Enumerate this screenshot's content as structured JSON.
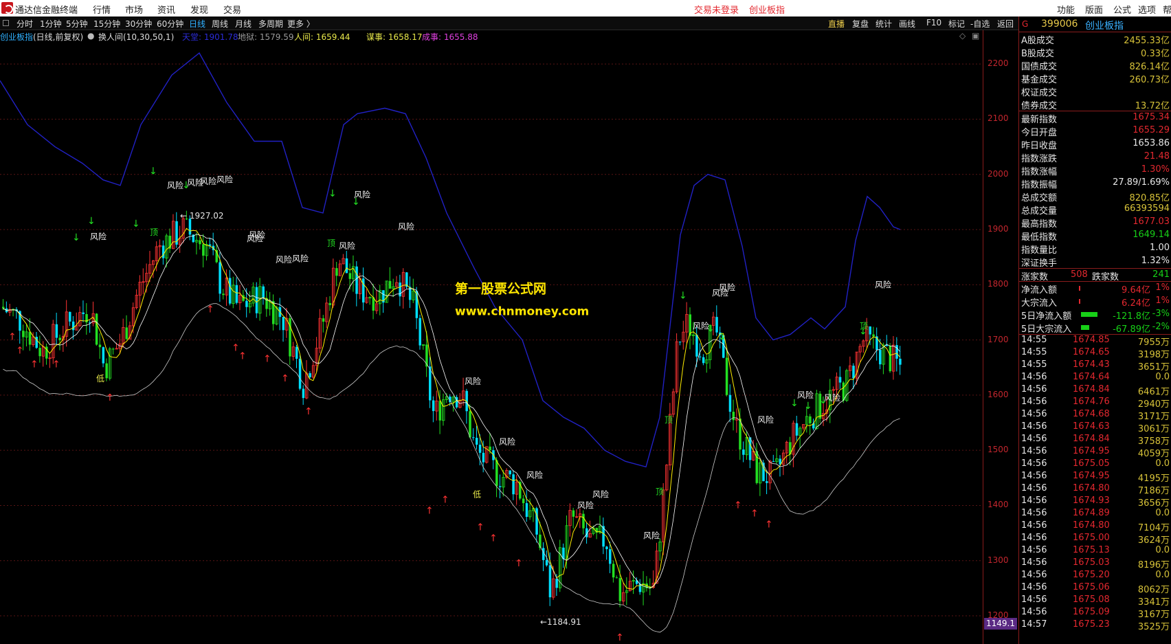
{
  "titlebar": {
    "app": "通达信金融终端",
    "menus": [
      "行情",
      "市场",
      "资讯",
      "发现",
      "交易"
    ],
    "login": "交易未登录",
    "board": "创业板指",
    "right_menus": [
      "功能",
      "版面",
      "公式",
      "选项",
      "帮"
    ]
  },
  "toolbar": {
    "periods": [
      "分时",
      "1分钟",
      "5分钟",
      "15分钟",
      "30分钟",
      "60分钟",
      "日线",
      "周线",
      "月线",
      "多周期",
      "更多 〉"
    ],
    "active": "日线",
    "right": [
      "直播",
      "复盘",
      "统计",
      "画线",
      "F10",
      "标记",
      "-自选",
      "返回"
    ]
  },
  "indicator": {
    "name": "创业板指",
    "mode": "(日线,前复权)",
    "formula": "换人间(10,30,50,1)",
    "tiantang": "天堂: 1901.78",
    "diyu": "地狱: 1579.59",
    "renjian": "人间: 1659.44",
    "moushi": "谋事: 1658.17",
    "chengshi": "成事: 1655.88"
  },
  "watermark": {
    "line1": "第一股票公式网",
    "line2": "www.chnmoney.com"
  },
  "chart_data": {
    "type": "candlestick",
    "ylim": [
      1149,
      2240
    ],
    "yticks": [
      1200,
      1300,
      1400,
      1500,
      1600,
      1700,
      1800,
      1900,
      2000,
      2100,
      2200
    ],
    "current_price_label": "1149.1",
    "high_label": "1927.02",
    "low_label": "1184.91",
    "markers": {
      "risk": "风险",
      "top": "顶",
      "bottom": "低"
    },
    "colors": {
      "up": "#ff3333",
      "down": "#00e0ff",
      "up_alt": "#22e022",
      "band_upper": "#2121c4",
      "band_lower": "#cccccc",
      "ma_fast": "#ffee00",
      "ma_slow": "#ffffff"
    }
  },
  "panel": {
    "code": "399006",
    "name": "创业板指",
    "g": "G",
    "turnover": [
      {
        "label": "A股成交",
        "value": "2455.33亿"
      },
      {
        "label": "B股成交",
        "value": "0.33亿"
      },
      {
        "label": "国债成交",
        "value": "826.14亿"
      },
      {
        "label": "基金成交",
        "value": "260.73亿"
      },
      {
        "label": "权证成交",
        "value": ""
      },
      {
        "label": "债券成交",
        "value": "13.72亿"
      }
    ],
    "stats": [
      {
        "label": "最新指数",
        "value": "1675.34",
        "c": "red"
      },
      {
        "label": "今日开盘",
        "value": "1655.29",
        "c": "red"
      },
      {
        "label": "昨日收盘",
        "value": "1653.86",
        "c": "wht"
      },
      {
        "label": "指数涨跌",
        "value": "21.48",
        "c": "red"
      },
      {
        "label": "指数涨幅",
        "value": "1.30%",
        "c": "red"
      },
      {
        "label": "指数振幅",
        "value": "27.89/1.69%",
        "c": "wht"
      },
      {
        "label": "总成交额",
        "value": "820.85亿",
        "c": "yel"
      },
      {
        "label": "总成交量",
        "value": "66393594",
        "c": "yel"
      },
      {
        "label": "最高指数",
        "value": "1677.03",
        "c": "red"
      },
      {
        "label": "最低指数",
        "value": "1649.14",
        "c": "grn"
      },
      {
        "label": "指数量比",
        "value": "1.00",
        "c": "wht"
      },
      {
        "label": "深证换手",
        "value": "1.32%",
        "c": "wht"
      }
    ],
    "updown": {
      "up_label": "涨家数",
      "up": "508",
      "down_label": "跌家数",
      "down": "241"
    },
    "flows": [
      {
        "label": "净流入额",
        "value": "9.64亿",
        "pct": "1%",
        "c": "red",
        "bar": 0.02
      },
      {
        "label": "大宗流入",
        "value": "6.24亿",
        "pct": "1%",
        "c": "red",
        "bar": 0.02
      },
      {
        "label": "5日净流入额",
        "value": "-121.8亿",
        "pct": "-3%",
        "c": "grn",
        "bar": 0.6
      },
      {
        "label": "5日大宗流入",
        "value": "-67.89亿",
        "pct": "-2%",
        "c": "grn",
        "bar": 0.3
      }
    ],
    "ticks": [
      {
        "t": "14:55",
        "p": "1674.85",
        "q": "7955万"
      },
      {
        "t": "14:55",
        "p": "1674.65",
        "q": "3198万"
      },
      {
        "t": "14:55",
        "p": "1674.43",
        "q": "3651万"
      },
      {
        "t": "14:56",
        "p": "1674.64",
        "q": "0.0"
      },
      {
        "t": "14:56",
        "p": "1674.84",
        "q": "6461万"
      },
      {
        "t": "14:56",
        "p": "1674.76",
        "q": "2940万"
      },
      {
        "t": "14:56",
        "p": "1674.68",
        "q": "3171万"
      },
      {
        "t": "14:56",
        "p": "1674.63",
        "q": "3061万"
      },
      {
        "t": "14:56",
        "p": "1674.84",
        "q": "3758万"
      },
      {
        "t": "14:56",
        "p": "1674.95",
        "q": "4059万"
      },
      {
        "t": "14:56",
        "p": "1675.05",
        "q": "0.0"
      },
      {
        "t": "14:56",
        "p": "1674.95",
        "q": "4195万"
      },
      {
        "t": "14:56",
        "p": "1674.80",
        "q": "7186万"
      },
      {
        "t": "14:56",
        "p": "1674.93",
        "q": "3656万"
      },
      {
        "t": "14:56",
        "p": "1674.89",
        "q": "0.0"
      },
      {
        "t": "14:56",
        "p": "1674.80",
        "q": "7104万"
      },
      {
        "t": "14:56",
        "p": "1675.00",
        "q": "3624万"
      },
      {
        "t": "14:56",
        "p": "1675.13",
        "q": "0.0"
      },
      {
        "t": "14:56",
        "p": "1675.03",
        "q": "8196万"
      },
      {
        "t": "14:56",
        "p": "1675.20",
        "q": "0.0"
      },
      {
        "t": "14:56",
        "p": "1675.06",
        "q": "8062万"
      },
      {
        "t": "14:56",
        "p": "1675.08",
        "q": "3341万"
      },
      {
        "t": "14:56",
        "p": "1675.09",
        "q": "3167万"
      },
      {
        "t": "14:57",
        "p": "1675.23",
        "q": "3525万"
      }
    ]
  }
}
